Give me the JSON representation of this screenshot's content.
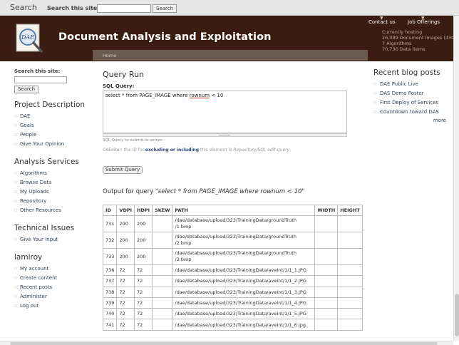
{
  "topbar": {
    "title": "Search",
    "label": "Search this site:",
    "button": "Search"
  },
  "header": {
    "site_title": "Document Analysis and Exploitation",
    "logo_text": "DAE",
    "links": [
      "Contact us",
      "Job Offerings"
    ],
    "stats": [
      "Currently hosting",
      "26,089 Document Images (43G",
      "7 Algorithms",
      "70,730 Data Items"
    ]
  },
  "breadcrumb": "Home",
  "left": {
    "search_title": "Search this site:",
    "search_button": "Search",
    "sections": [
      {
        "title": "Project Description",
        "items": [
          "DAE",
          "Goals",
          "People",
          "Give Your Opinion"
        ]
      },
      {
        "title": "Analysis Services",
        "items": [
          "Algorithms",
          "Browse Data",
          "My Uploads",
          "Repository",
          "Other Resources"
        ]
      },
      {
        "title": "Technical Issues",
        "items": [
          "Give Your Input"
        ]
      },
      {
        "title": "lamiroy",
        "items": [
          "My account",
          "Create content",
          "Recent posts",
          "Administer",
          "Log out"
        ]
      }
    ]
  },
  "main": {
    "title": "Query Run",
    "sql_label": "SQL Query:",
    "sql_pre": "select * from PAGE_IMAGE where ",
    "sql_underlined": "rownum",
    "sql_post": " < 10",
    "hint": "SQL Query to submit to server.",
    "ck_pre": "CKEditor: the ID for ",
    "ck_bold": "excluding or including",
    "ck_mid": " this element is ",
    "ck_italic": "Repository/SQL edit-query",
    "ck_post": ".",
    "submit": "Submit Query",
    "output_prefix": "Output for query \"",
    "output_query": "select * from PAGE_IMAGE where rownum < 10",
    "output_suffix": "\""
  },
  "table": {
    "headers": [
      "ID",
      "VDPI",
      "HDPI",
      "SKEW",
      "PATH",
      "WIDTH",
      "HEIGHT"
    ],
    "rows": [
      [
        "731",
        "200",
        "200",
        "",
        "/dae/database/upload/323/TrainingData/groundTruth /1.bmp",
        "",
        ""
      ],
      [
        "732",
        "200",
        "200",
        "",
        "/dae/database/upload/323/TrainingData/groundTruth /2.bmp",
        "",
        ""
      ],
      [
        "733",
        "200",
        "200",
        "",
        "/dae/database/upload/323/TrainingData/groundTruth /3.bmp",
        "",
        ""
      ],
      [
        "736",
        "72",
        "72",
        "",
        "/dae/database/upload/323/TrainingData/aveInt/1/1_1.JPG",
        "",
        ""
      ],
      [
        "737",
        "72",
        "72",
        "",
        "/dae/database/upload/323/TrainingData/aveInt/1/1_2.JPG",
        "",
        ""
      ],
      [
        "738",
        "72",
        "72",
        "",
        "/dae/database/upload/323/TrainingData/aveInt/1/1_3.JPG",
        "",
        ""
      ],
      [
        "739",
        "72",
        "72",
        "",
        "/dae/database/upload/323/TrainingData/aveInt/1/1_4.JPG",
        "",
        ""
      ],
      [
        "740",
        "72",
        "72",
        "",
        "/dae/database/upload/323/TrainingData/aveInt/1/1_5.JPG",
        "",
        ""
      ],
      [
        "741",
        "72",
        "72",
        "",
        "/dae/database/upload/323/TrainingData/aveInt/1/1_6.jpg",
        "",
        ""
      ]
    ]
  },
  "right": {
    "title": "Recent blog posts",
    "items": [
      "DAE Public Live",
      "DAS Demo Poster",
      "First Deploy of Services",
      "Countdown toward DAS"
    ],
    "more": "more"
  },
  "colors": {
    "header": "#3a1d10",
    "crumbbar": "#6b5a50",
    "link": "#334455"
  }
}
